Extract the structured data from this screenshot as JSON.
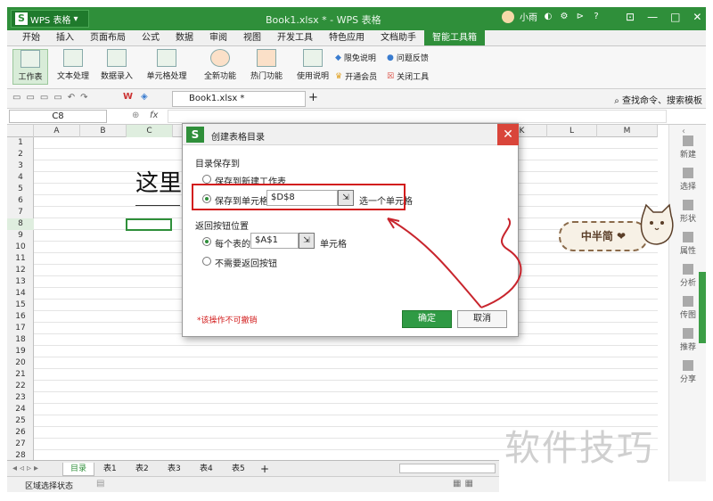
{
  "app": {
    "logo_label": "WPS 表格",
    "window_title": "Book1.xlsx * - WPS 表格",
    "user_name": "小雨"
  },
  "menu": {
    "tabs": [
      "开始",
      "插入",
      "页面布局",
      "公式",
      "数据",
      "审阅",
      "视图",
      "开发工具",
      "特色应用",
      "文档助手",
      "智能工具箱"
    ],
    "active_index": 10
  },
  "ribbon": {
    "buttons": [
      "工作表",
      "文本处理",
      "数据录入",
      "单元格处理",
      "全新功能",
      "热门功能",
      "使用说明"
    ],
    "small": [
      "限免说明",
      "问题反馈",
      "开通会员",
      "关闭工具"
    ]
  },
  "quickbar": {
    "doc_tab": "Book1.xlsx *",
    "search": "查找命令、搜索模板"
  },
  "formula": {
    "cell_ref": "C8",
    "fx": "fx"
  },
  "grid": {
    "columns": [
      "A",
      "B",
      "C",
      "D",
      "E",
      "F",
      "G",
      "H",
      "I",
      "J",
      "K",
      "L",
      "M"
    ],
    "rows": [
      "1",
      "2",
      "3",
      "4",
      "5",
      "6",
      "7",
      "8",
      "9",
      "10",
      "11",
      "12",
      "13",
      "14",
      "15",
      "16",
      "17",
      "18",
      "19",
      "20",
      "21",
      "22",
      "23",
      "24",
      "25",
      "26",
      "27",
      "28"
    ],
    "cell_text": "这里"
  },
  "sidebar": {
    "items": [
      "新建",
      "选择",
      "形状",
      "属性",
      "分析",
      "传图",
      "推荐",
      "分享"
    ]
  },
  "sheets": {
    "tabs": [
      "目录",
      "表1",
      "表2",
      "表3",
      "表4",
      "表5"
    ],
    "active_index": 0,
    "add": "+"
  },
  "status": {
    "text": "区域选择状态"
  },
  "dialog": {
    "title": "创建表格目录",
    "section_save": "目录保存到",
    "opt_new_sheet": "保存到新建工作表",
    "opt_cell": "保存到单元格",
    "cell_value": "$D$8",
    "hint": "选一个单元格",
    "section_return": "返回按钮位置",
    "opt_each": "每个表的",
    "each_value": "$A$1",
    "each_suffix": "单元格",
    "opt_none": "不需要返回按钮",
    "note": "*该操作不可撤销",
    "ok": "确定",
    "cancel": "取消",
    "selected_save": "cell",
    "selected_return": "each"
  },
  "decor": {
    "sticker": "中半简 ❤",
    "watermark": "软件技巧"
  }
}
